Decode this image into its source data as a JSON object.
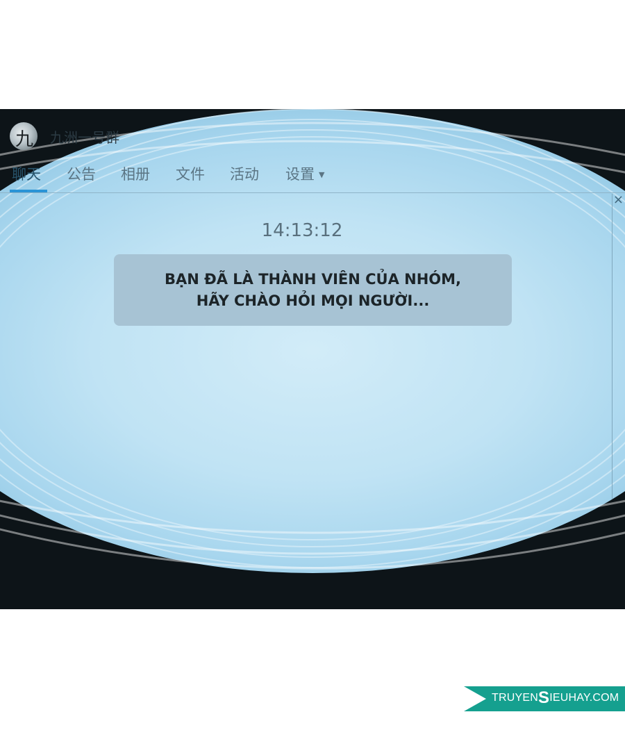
{
  "group": {
    "name": "九洲一号群",
    "avatar_char": "九"
  },
  "tabs": [
    {
      "label": "聊天",
      "active": true
    },
    {
      "label": "公告",
      "active": false
    },
    {
      "label": "相册",
      "active": false
    },
    {
      "label": "文件",
      "active": false
    },
    {
      "label": "活动",
      "active": false
    },
    {
      "label": "设置",
      "active": false,
      "dropdown": true
    }
  ],
  "close_icon": "×",
  "chat": {
    "timestamp": "14:13:12",
    "system_message": "BẠN ĐÃ LÀ THÀNH VIÊN CỦA NHÓM, HÃY CHÀO HỎI MỌI NGƯỜI..."
  },
  "watermark": {
    "prefix": "TRUYEN",
    "big_letter": "S",
    "suffix": "IEUHAY.COM",
    "color": "#15a08f"
  },
  "colors": {
    "accent_tab": "#2a94d6",
    "bubble": "#a7c3d4"
  }
}
